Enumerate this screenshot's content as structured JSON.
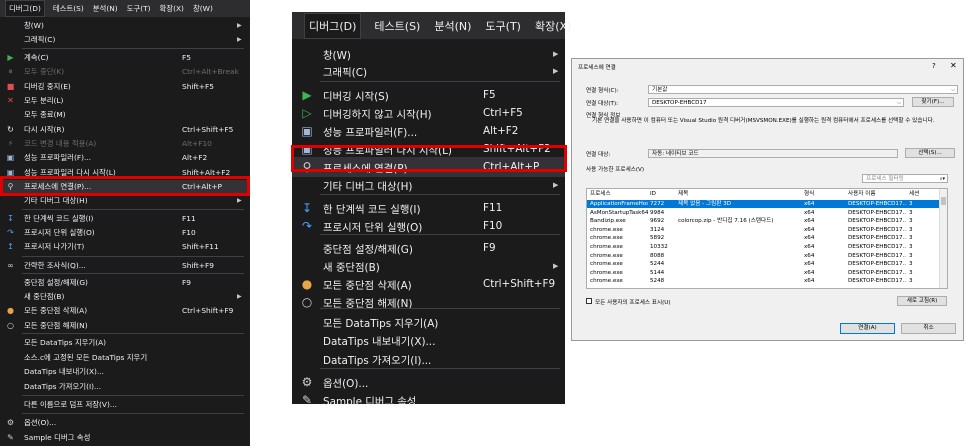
{
  "left_menu": {
    "menubar": [
      "디버그(D)",
      "테스트(S)",
      "분석(N)",
      "도구(T)",
      "확장(X)",
      "창(W)"
    ],
    "items": [
      {
        "label": "창(W)",
        "shortcut": "",
        "icon": "",
        "arrow": true
      },
      {
        "label": "그래픽(C)",
        "shortcut": "",
        "icon": "",
        "arrow": true
      },
      {
        "label": "계속(C)",
        "shortcut": "F5",
        "icon": "play-icon"
      },
      {
        "label": "모두 중단(K)",
        "shortcut": "Ctrl+Alt+Break",
        "icon": "pause-icon",
        "disabled": true
      },
      {
        "label": "디버깅 중지(E)",
        "shortcut": "Shift+F5",
        "icon": "stop-icon"
      },
      {
        "label": "모두 분리(L)",
        "shortcut": "",
        "icon": "close-icon"
      },
      {
        "label": "모두 종료(M)",
        "shortcut": "",
        "icon": ""
      },
      {
        "label": "다시 시작(R)",
        "shortcut": "Ctrl+Shift+F5",
        "icon": "restart-icon"
      },
      {
        "label": "코드 변경 내용 적용(A)",
        "shortcut": "Alt+F10",
        "icon": "hot-reload-icon",
        "disabled": true
      },
      {
        "label": "성능 프로파일러(F)...",
        "shortcut": "Alt+F2",
        "icon": "profiler-icon"
      },
      {
        "label": "성능 프로파일러 다시 시작(L)",
        "shortcut": "Shift+Alt+F2",
        "icon": "profiler-icon"
      },
      {
        "label": "프로세스에 연결(P)...",
        "shortcut": "Ctrl+Alt+P",
        "icon": "attach-icon",
        "highlight": true
      },
      {
        "label": "기타 디버그 대상(H)",
        "shortcut": "",
        "icon": "",
        "arrow": true
      },
      {
        "label": "한 단계씩 코드 실행(I)",
        "shortcut": "F11",
        "icon": "step-into-icon"
      },
      {
        "label": "프로시저 단위 실행(O)",
        "shortcut": "F10",
        "icon": "step-over-icon"
      },
      {
        "label": "프로시저 나가기(T)",
        "shortcut": "Shift+F11",
        "icon": "step-out-icon"
      },
      {
        "label": "간략한 조사식(Q)...",
        "shortcut": "Shift+F9",
        "icon": "glasses-icon"
      },
      {
        "label": "중단점 설정/해제(G)",
        "shortcut": "F9",
        "icon": ""
      },
      {
        "label": "새 중단점(B)",
        "shortcut": "",
        "icon": "",
        "arrow": true
      },
      {
        "label": "모든 중단점 삭제(A)",
        "shortcut": "Ctrl+Shift+F9",
        "icon": "delete-breakpoints-icon"
      },
      {
        "label": "모든 중단점 해제(N)",
        "shortcut": "",
        "icon": "disable-breakpoints-icon"
      },
      {
        "label": "모든 DataTips 지우기(A)",
        "shortcut": "",
        "icon": ""
      },
      {
        "label": "소스.c에 고정된 모든 DataTips 지우기",
        "shortcut": "",
        "icon": ""
      },
      {
        "label": "DataTips 내보내기(X)...",
        "shortcut": "",
        "icon": ""
      },
      {
        "label": "DataTips 가져오기(I)...",
        "shortcut": "",
        "icon": ""
      },
      {
        "label": "다른 이름으로 덤프 저장(V)...",
        "shortcut": "",
        "icon": ""
      },
      {
        "label": "옵션(O)...",
        "shortcut": "",
        "icon": "gear-icon"
      },
      {
        "label": "Sample 디버그 속성",
        "shortcut": "",
        "icon": "wrench-icon"
      }
    ]
  },
  "mid_menu": {
    "menubar": [
      "디버그(D)",
      "테스트(S)",
      "분석(N)",
      "도구(T)",
      "확장(X)"
    ],
    "items": [
      {
        "label": "창(W)",
        "shortcut": "",
        "icon": "",
        "arrow": true
      },
      {
        "label": "그래픽(C)",
        "shortcut": "",
        "icon": "",
        "arrow": true
      },
      {
        "label": "디버깅 시작(S)",
        "shortcut": "F5",
        "icon": "play-icon"
      },
      {
        "label": "디버깅하지 않고 시작(H)",
        "shortcut": "Ctrl+F5",
        "icon": "play-outline-icon"
      },
      {
        "label": "성능 프로파일러(F)...",
        "shortcut": "Alt+F2",
        "icon": "profiler-icon"
      },
      {
        "label": "성능 프로파일러 다시 시작(L)",
        "shortcut": "Shift+Alt+F2",
        "icon": "profiler-icon"
      },
      {
        "label": "프로세스에 연결(P)...",
        "shortcut": "Ctrl+Alt+P",
        "icon": "attach-icon",
        "highlight": true
      },
      {
        "label": "기타 디버그 대상(H)",
        "shortcut": "",
        "icon": "",
        "arrow": true
      },
      {
        "label": "한 단계씩 코드 실행(I)",
        "shortcut": "F11",
        "icon": "step-into-icon"
      },
      {
        "label": "프로시저 단위 실행(O)",
        "shortcut": "F10",
        "icon": "step-over-icon"
      },
      {
        "label": "중단점 설정/해제(G)",
        "shortcut": "F9",
        "icon": ""
      },
      {
        "label": "새 중단점(B)",
        "shortcut": "",
        "icon": "",
        "arrow": true
      },
      {
        "label": "모든 중단점 삭제(A)",
        "shortcut": "Ctrl+Shift+F9",
        "icon": "delete-breakpoints-icon"
      },
      {
        "label": "모든 중단점 해제(N)",
        "shortcut": "",
        "icon": "disable-breakpoints-icon"
      },
      {
        "label": "모든 DataTips 지우기(A)",
        "shortcut": "",
        "icon": ""
      },
      {
        "label": "DataTips 내보내기(X)...",
        "shortcut": "",
        "icon": ""
      },
      {
        "label": "DataTips 가져오기(I)...",
        "shortcut": "",
        "icon": ""
      },
      {
        "label": "옵션(O)...",
        "shortcut": "",
        "icon": "gear-icon"
      },
      {
        "label": "Sample 디버그 속성",
        "shortcut": "",
        "icon": "wrench-icon"
      }
    ]
  },
  "dialog": {
    "title": "프로세스에 연결",
    "help": "?",
    "close": "✕",
    "conn_type_label": "연결 형식(C):",
    "conn_type_value": "기본값",
    "conn_target_label": "연결 대상(T):",
    "conn_target_value": "DESKTOP-EHBCD17",
    "find_button": "찾기(F)...",
    "conn_info_label": "연결 형식 정보",
    "conn_info_text": "기본 연결을 사용하면 이 컴퓨터 또는 Visual Studio 원격 디버거(MSVSMON.EXE)를 실행하는 원격 컴퓨터에서 프로세스를 선택할 수 있습니다.",
    "attach_target_label": "연결 대상:",
    "attach_target_value": "자동: 네이티브 코드",
    "select_button": "선택(S)...",
    "available_label": "사용 가능한 프로세스(V)",
    "filter_placeholder": "프로세스 필터링",
    "columns": [
      "프로세스",
      "ID",
      "제목",
      "형식",
      "사용자 이름",
      "세션"
    ],
    "rows": [
      [
        "ApplicationFrameHos...",
        "7272",
        "제목 없음 - 그림판 3D",
        "x64",
        "DESKTOP-EHBCD17...",
        "3"
      ],
      [
        "AsMonStartupTask64...",
        "9984",
        "",
        "x64",
        "DESKTOP-EHBCD17...",
        "3"
      ],
      [
        "Bandizip.exe",
        "9692",
        "colorcop.zip - 반디집 7.16 (스탠다드)",
        "x64",
        "DESKTOP-EHBCD17...",
        "3"
      ],
      [
        "chrome.exe",
        "3124",
        "",
        "x64",
        "DESKTOP-EHBCD17...",
        "3"
      ],
      [
        "chrome.exe",
        "5892",
        "",
        "x64",
        "DESKTOP-EHBCD17...",
        "3"
      ],
      [
        "chrome.exe",
        "10332",
        "",
        "x64",
        "DESKTOP-EHBCD17...",
        "3"
      ],
      [
        "chrome.exe",
        "8088",
        "",
        "x64",
        "DESKTOP-EHBCD17...",
        "3"
      ],
      [
        "chrome.exe",
        "5244",
        "",
        "x64",
        "DESKTOP-EHBCD17...",
        "3"
      ],
      [
        "chrome.exe",
        "5144",
        "",
        "x64",
        "DESKTOP-EHBCD17...",
        "3"
      ],
      [
        "chrome.exe",
        "5248",
        "",
        "x64",
        "DESKTOP-EHBCD17...",
        "3"
      ]
    ],
    "show_all_label": "모든 사용자의 프로세스 표시(U)",
    "refresh_button": "새로 고침(R)",
    "attach_button": "연결(A)",
    "cancel_button": "취소"
  },
  "colors": {
    "menu_bg": "#1b1b1c",
    "highlight_box": "#e00000",
    "selection": "#0078d7"
  }
}
